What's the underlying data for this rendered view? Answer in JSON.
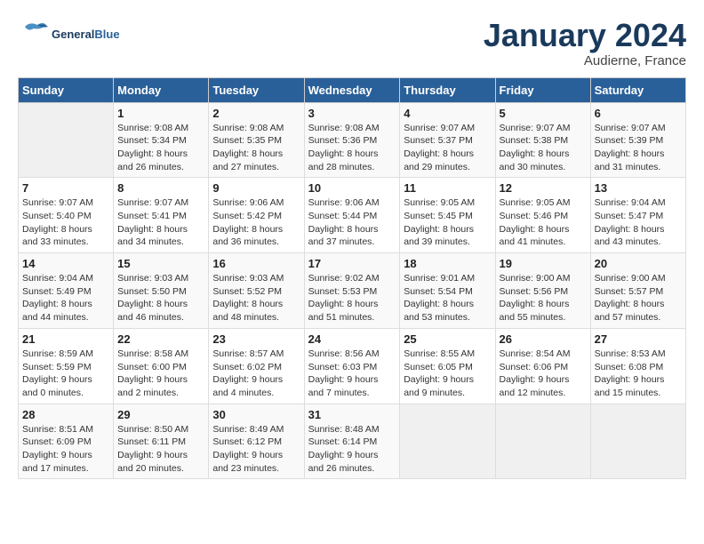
{
  "header": {
    "logo_general": "General",
    "logo_blue": "Blue",
    "month_title": "January 2024",
    "location": "Audierne, France"
  },
  "weekdays": [
    "Sunday",
    "Monday",
    "Tuesday",
    "Wednesday",
    "Thursday",
    "Friday",
    "Saturday"
  ],
  "weeks": [
    [
      {
        "day": "",
        "sunrise": "",
        "sunset": "",
        "daylight": ""
      },
      {
        "day": "1",
        "sunrise": "Sunrise: 9:08 AM",
        "sunset": "Sunset: 5:34 PM",
        "daylight": "Daylight: 8 hours and 26 minutes."
      },
      {
        "day": "2",
        "sunrise": "Sunrise: 9:08 AM",
        "sunset": "Sunset: 5:35 PM",
        "daylight": "Daylight: 8 hours and 27 minutes."
      },
      {
        "day": "3",
        "sunrise": "Sunrise: 9:08 AM",
        "sunset": "Sunset: 5:36 PM",
        "daylight": "Daylight: 8 hours and 28 minutes."
      },
      {
        "day": "4",
        "sunrise": "Sunrise: 9:07 AM",
        "sunset": "Sunset: 5:37 PM",
        "daylight": "Daylight: 8 hours and 29 minutes."
      },
      {
        "day": "5",
        "sunrise": "Sunrise: 9:07 AM",
        "sunset": "Sunset: 5:38 PM",
        "daylight": "Daylight: 8 hours and 30 minutes."
      },
      {
        "day": "6",
        "sunrise": "Sunrise: 9:07 AM",
        "sunset": "Sunset: 5:39 PM",
        "daylight": "Daylight: 8 hours and 31 minutes."
      }
    ],
    [
      {
        "day": "7",
        "sunrise": "Sunrise: 9:07 AM",
        "sunset": "Sunset: 5:40 PM",
        "daylight": "Daylight: 8 hours and 33 minutes."
      },
      {
        "day": "8",
        "sunrise": "Sunrise: 9:07 AM",
        "sunset": "Sunset: 5:41 PM",
        "daylight": "Daylight: 8 hours and 34 minutes."
      },
      {
        "day": "9",
        "sunrise": "Sunrise: 9:06 AM",
        "sunset": "Sunset: 5:42 PM",
        "daylight": "Daylight: 8 hours and 36 minutes."
      },
      {
        "day": "10",
        "sunrise": "Sunrise: 9:06 AM",
        "sunset": "Sunset: 5:44 PM",
        "daylight": "Daylight: 8 hours and 37 minutes."
      },
      {
        "day": "11",
        "sunrise": "Sunrise: 9:05 AM",
        "sunset": "Sunset: 5:45 PM",
        "daylight": "Daylight: 8 hours and 39 minutes."
      },
      {
        "day": "12",
        "sunrise": "Sunrise: 9:05 AM",
        "sunset": "Sunset: 5:46 PM",
        "daylight": "Daylight: 8 hours and 41 minutes."
      },
      {
        "day": "13",
        "sunrise": "Sunrise: 9:04 AM",
        "sunset": "Sunset: 5:47 PM",
        "daylight": "Daylight: 8 hours and 43 minutes."
      }
    ],
    [
      {
        "day": "14",
        "sunrise": "Sunrise: 9:04 AM",
        "sunset": "Sunset: 5:49 PM",
        "daylight": "Daylight: 8 hours and 44 minutes."
      },
      {
        "day": "15",
        "sunrise": "Sunrise: 9:03 AM",
        "sunset": "Sunset: 5:50 PM",
        "daylight": "Daylight: 8 hours and 46 minutes."
      },
      {
        "day": "16",
        "sunrise": "Sunrise: 9:03 AM",
        "sunset": "Sunset: 5:52 PM",
        "daylight": "Daylight: 8 hours and 48 minutes."
      },
      {
        "day": "17",
        "sunrise": "Sunrise: 9:02 AM",
        "sunset": "Sunset: 5:53 PM",
        "daylight": "Daylight: 8 hours and 51 minutes."
      },
      {
        "day": "18",
        "sunrise": "Sunrise: 9:01 AM",
        "sunset": "Sunset: 5:54 PM",
        "daylight": "Daylight: 8 hours and 53 minutes."
      },
      {
        "day": "19",
        "sunrise": "Sunrise: 9:00 AM",
        "sunset": "Sunset: 5:56 PM",
        "daylight": "Daylight: 8 hours and 55 minutes."
      },
      {
        "day": "20",
        "sunrise": "Sunrise: 9:00 AM",
        "sunset": "Sunset: 5:57 PM",
        "daylight": "Daylight: 8 hours and 57 minutes."
      }
    ],
    [
      {
        "day": "21",
        "sunrise": "Sunrise: 8:59 AM",
        "sunset": "Sunset: 5:59 PM",
        "daylight": "Daylight: 9 hours and 0 minutes."
      },
      {
        "day": "22",
        "sunrise": "Sunrise: 8:58 AM",
        "sunset": "Sunset: 6:00 PM",
        "daylight": "Daylight: 9 hours and 2 minutes."
      },
      {
        "day": "23",
        "sunrise": "Sunrise: 8:57 AM",
        "sunset": "Sunset: 6:02 PM",
        "daylight": "Daylight: 9 hours and 4 minutes."
      },
      {
        "day": "24",
        "sunrise": "Sunrise: 8:56 AM",
        "sunset": "Sunset: 6:03 PM",
        "daylight": "Daylight: 9 hours and 7 minutes."
      },
      {
        "day": "25",
        "sunrise": "Sunrise: 8:55 AM",
        "sunset": "Sunset: 6:05 PM",
        "daylight": "Daylight: 9 hours and 9 minutes."
      },
      {
        "day": "26",
        "sunrise": "Sunrise: 8:54 AM",
        "sunset": "Sunset: 6:06 PM",
        "daylight": "Daylight: 9 hours and 12 minutes."
      },
      {
        "day": "27",
        "sunrise": "Sunrise: 8:53 AM",
        "sunset": "Sunset: 6:08 PM",
        "daylight": "Daylight: 9 hours and 15 minutes."
      }
    ],
    [
      {
        "day": "28",
        "sunrise": "Sunrise: 8:51 AM",
        "sunset": "Sunset: 6:09 PM",
        "daylight": "Daylight: 9 hours and 17 minutes."
      },
      {
        "day": "29",
        "sunrise": "Sunrise: 8:50 AM",
        "sunset": "Sunset: 6:11 PM",
        "daylight": "Daylight: 9 hours and 20 minutes."
      },
      {
        "day": "30",
        "sunrise": "Sunrise: 8:49 AM",
        "sunset": "Sunset: 6:12 PM",
        "daylight": "Daylight: 9 hours and 23 minutes."
      },
      {
        "day": "31",
        "sunrise": "Sunrise: 8:48 AM",
        "sunset": "Sunset: 6:14 PM",
        "daylight": "Daylight: 9 hours and 26 minutes."
      },
      {
        "day": "",
        "sunrise": "",
        "sunset": "",
        "daylight": ""
      },
      {
        "day": "",
        "sunrise": "",
        "sunset": "",
        "daylight": ""
      },
      {
        "day": "",
        "sunrise": "",
        "sunset": "",
        "daylight": ""
      }
    ]
  ]
}
